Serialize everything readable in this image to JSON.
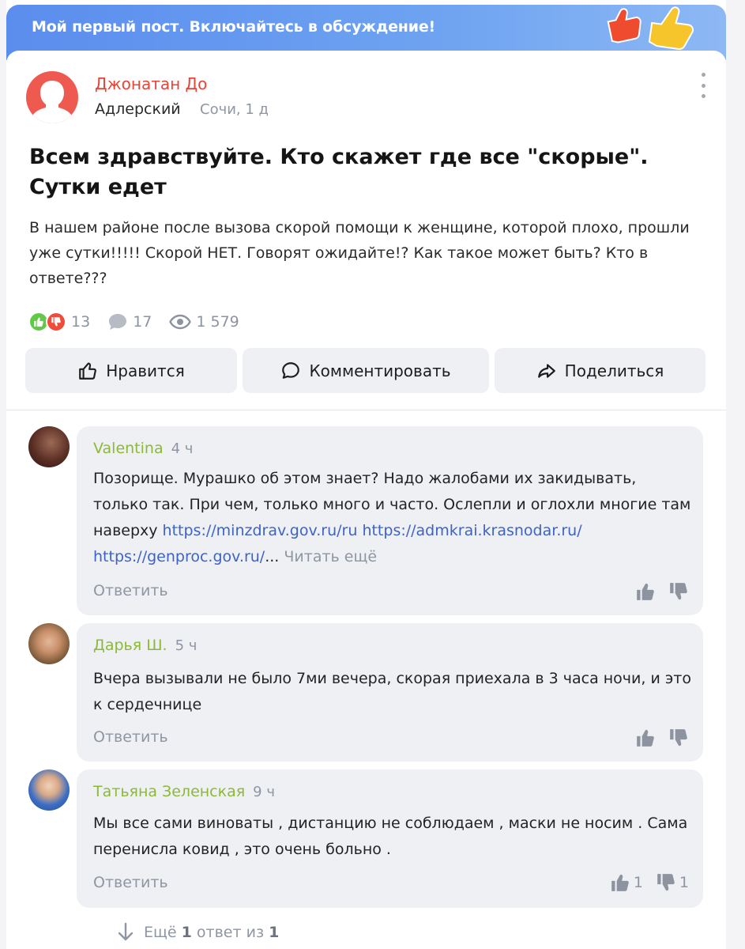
{
  "banner": {
    "text": "Мой первый пост. Включайтесь в обсуждение!"
  },
  "post": {
    "author": "Джонатан До",
    "location": "Адлерский",
    "meta": "Сочи, 1 д",
    "title": "Всем здравствуйте. Кто скажет где все \"скорые\". Сутки едет",
    "body": "В нашем районе после вызова скорой помощи к женщине, которой плохо, прошли уже сутки!!!!! Скорой НЕТ. Говорят ожидайте!? Как такое может быть? Кто в ответе???",
    "stats": {
      "reactions": "13",
      "comments": "17",
      "views": "1 579"
    }
  },
  "actions": {
    "like": "Нравится",
    "comment": "Комментировать",
    "share": "Поделиться"
  },
  "comments": [
    {
      "name": "Valentina",
      "time": "4 ч",
      "text": "Позорище. Мурашко об этом знает? Надо жалобами их закидывать, только так. При чем, только много и часто.  Ослепли и оглохли многие там наверху ",
      "link1": "https://minzdrav.gov.ru/ru",
      "link2": "https://admkrai.krasnodar.ru/",
      "link3": "https://genproc.gov.ru/",
      "ellipsis": "...",
      "more": "Читать ещё",
      "reply": "Ответить"
    },
    {
      "name": "Дарья Ш.",
      "time": "5 ч",
      "text": "Вчера вызывали не было 7ми вечера, скорая приехала в 3 часа ночи, и это к сердечнице",
      "reply": "Ответить"
    },
    {
      "name": "Татьяна Зеленская",
      "time": "9 ч",
      "text": "Мы все сами виноваты , дистанцию не соблюдаем , маски не носим . Сама перенисла ковид , это очень больно .",
      "reply": "Ответить",
      "likes": "1",
      "dislikes": "1"
    }
  ],
  "more_replies": {
    "prefix": "Ещё",
    "count": "1",
    "middle": "ответ из",
    "total": "1"
  },
  "colors": {
    "author": "#e64437",
    "commenter": "#8cb936",
    "link": "#3e63c6",
    "banner": "#5b8dee",
    "button_bg": "#eef0f3"
  }
}
